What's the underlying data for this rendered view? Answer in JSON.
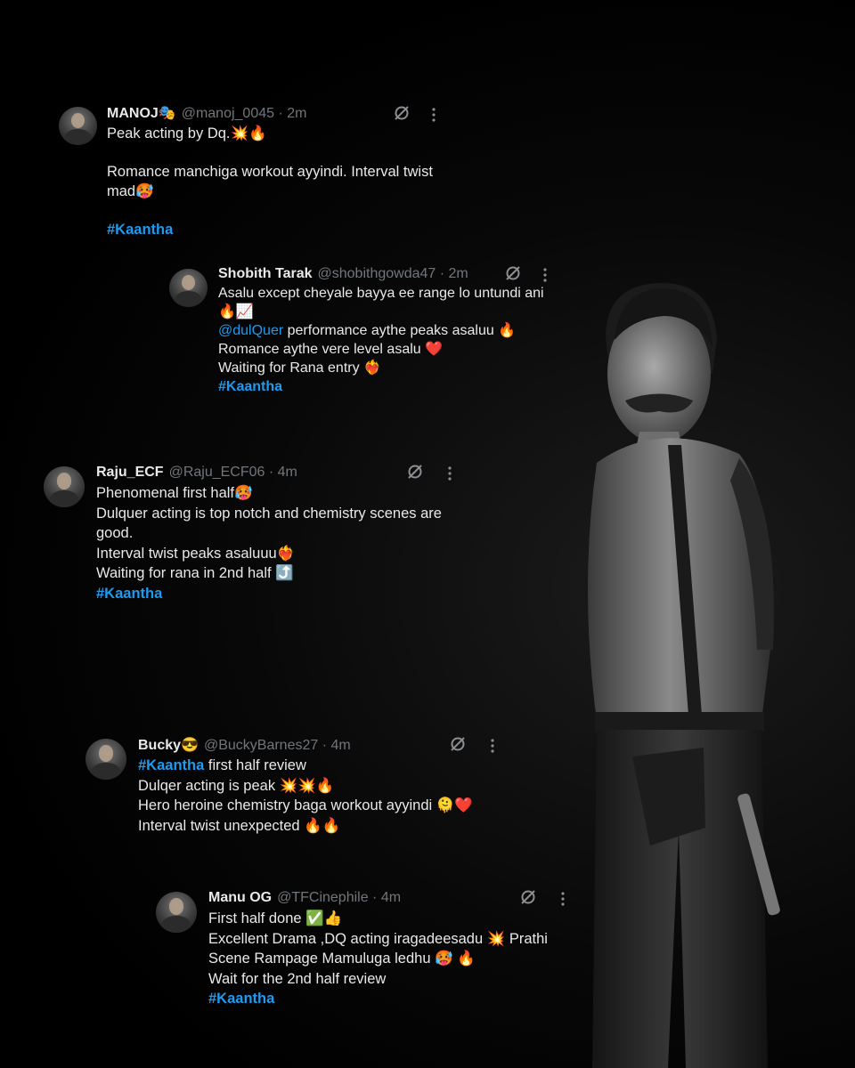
{
  "tweets": [
    {
      "name": "MANOJ🎭",
      "handle": "@manoj_0045 · 2m",
      "lines": [
        "Peak acting by Dq.💥🔥",
        "",
        "Romance manchiga workout ayyindi. Interval twist",
        "mad🥵",
        ""
      ],
      "hashtag": "#Kaantha"
    },
    {
      "name": "Shobith Tarak",
      "handle": "@shobithgowda47 · 2m",
      "line1": "Asalu except cheyale bayya ee range lo untundi ani",
      "line2": "🔥📈",
      "mention": "@dulQuer",
      "line3_rest": " performance aythe peaks asaluu 🔥",
      "line4": "Romance aythe vere level asalu ❤️",
      "line5": "Waiting for Rana entry ❤️‍🔥",
      "hashtag": "#Kaantha"
    },
    {
      "name": "Raju_ECF",
      "handle": "@Raju_ECF06 · 4m",
      "lines": [
        "Phenomenal first half🥵",
        "Dulquer acting is top notch and chemistry scenes are",
        "good.",
        "Interval twist peaks asaluuu❤️‍🔥",
        "Waiting for rana in 2nd half ⤴️"
      ],
      "hashtag": "#Kaantha"
    },
    {
      "name": "Bucky😎",
      "handle": "@BuckyBarnes27 · 4m",
      "hashtag": "#Kaantha",
      "line1_rest": " first half review",
      "lines": [
        "Dulqer acting is peak 💥💥🔥",
        "Hero heroine chemistry baga workout ayyindi 🫠❤️",
        "Interval twist unexpected 🔥🔥"
      ]
    },
    {
      "name": "Manu OG",
      "handle": "@TFCinephile · 4m",
      "lines": [
        "First half done ✅👍",
        "Excellent Drama ,DQ acting iragadeesadu 💥 Prathi",
        "Scene Rampage Mamuluga ledhu 🥵 🔥",
        "Wait for the 2nd half review"
      ],
      "hashtag": "#Kaantha"
    }
  ],
  "icons": {
    "grok": "grok-icon",
    "more": "more-options-icon"
  },
  "colors": {
    "background": "#000000",
    "text": "#e7e9ea",
    "handle": "#71767b",
    "hashtag": "#1d9bf0"
  }
}
